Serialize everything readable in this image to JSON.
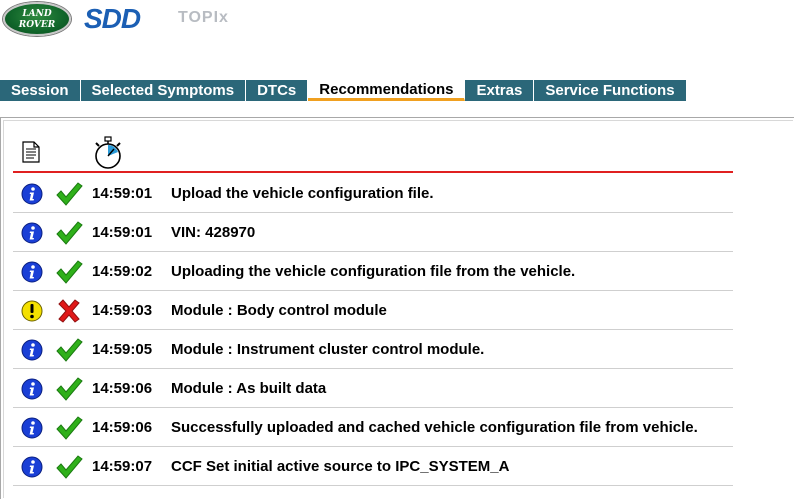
{
  "header": {
    "brand_line1": "LAND",
    "brand_line2": "ROVER",
    "product": "SDD",
    "subtitle": "TOPIx"
  },
  "tabs": [
    {
      "label": "Session",
      "active": false
    },
    {
      "label": "Selected Symptoms",
      "active": false
    },
    {
      "label": "DTCs",
      "active": false
    },
    {
      "label": "Recommendations",
      "active": true
    },
    {
      "label": "Extras",
      "active": false
    },
    {
      "label": "Service Functions",
      "active": false
    }
  ],
  "columns": {
    "type_icon": "document-icon",
    "time_icon": "stopwatch-icon"
  },
  "colors": {
    "tab_bg": "#2b6779",
    "active_tab_underline": "#f0a020",
    "header_rule": "#e02020",
    "info_blue": "#1a3fd6",
    "warning_yellow": "#f4e000",
    "success_green": "#2fb01a",
    "error_red": "#e01818"
  },
  "log": {
    "rows": [
      {
        "type": "info",
        "status": "success",
        "time": "14:59:01",
        "message": "Upload the vehicle configuration file."
      },
      {
        "type": "info",
        "status": "success",
        "time": "14:59:01",
        "message": "VIN: 428970"
      },
      {
        "type": "info",
        "status": "success",
        "time": "14:59:02",
        "message": "Uploading the vehicle configuration file from the vehicle."
      },
      {
        "type": "warning",
        "status": "error",
        "time": "14:59:03",
        "message": "Module : Body control module"
      },
      {
        "type": "info",
        "status": "success",
        "time": "14:59:05",
        "message": "Module : Instrument cluster control module."
      },
      {
        "type": "info",
        "status": "success",
        "time": "14:59:06",
        "message": "Module : As built data"
      },
      {
        "type": "info",
        "status": "success",
        "time": "14:59:06",
        "message": "Successfully uploaded and cached vehicle configuration file from vehicle."
      },
      {
        "type": "info",
        "status": "success",
        "time": "14:59:07",
        "message": "CCF Set initial active source to IPC_SYSTEM_A"
      }
    ]
  }
}
